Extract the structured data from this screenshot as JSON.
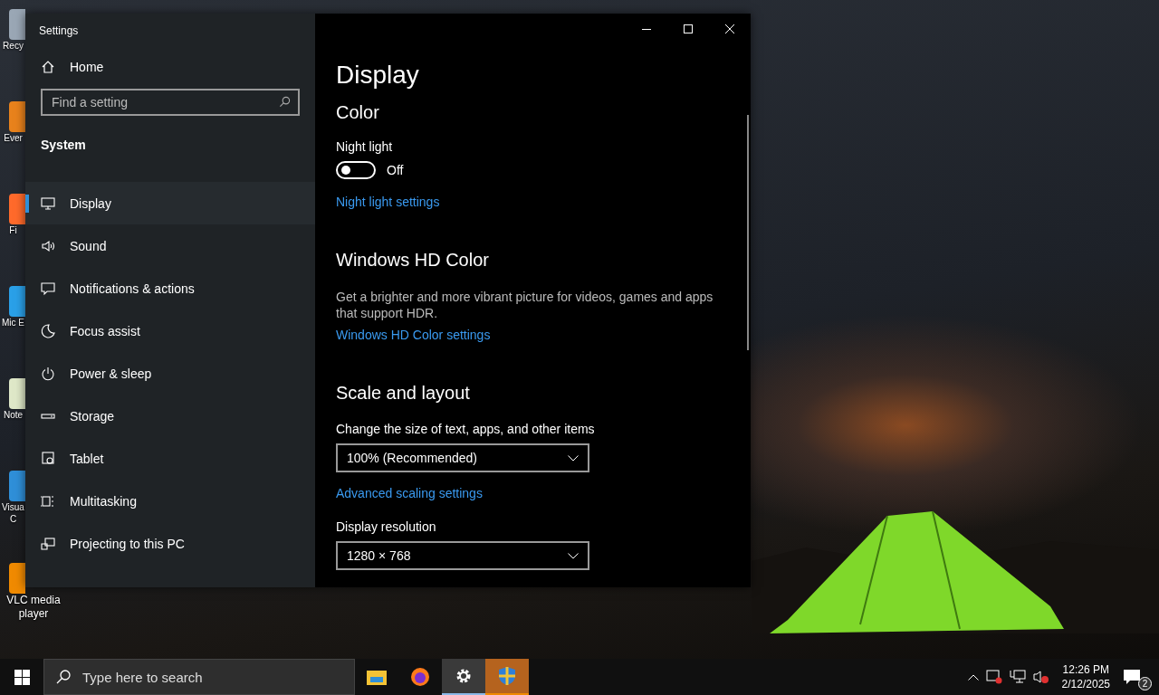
{
  "desktop_icons": [
    {
      "label": "Recy"
    },
    {
      "label": "Ever"
    },
    {
      "label": "Fi"
    },
    {
      "label": "Mic E"
    },
    {
      "label": "Note"
    },
    {
      "label": "Visua C"
    },
    {
      "label": "VLC media player"
    }
  ],
  "window": {
    "title": "Settings"
  },
  "sidebar": {
    "home": "Home",
    "search": {
      "placeholder": "Find a setting"
    },
    "section": "System",
    "items": [
      {
        "label": "Display",
        "selected": true
      },
      {
        "label": "Sound",
        "selected": false
      },
      {
        "label": "Notifications & actions",
        "selected": false
      },
      {
        "label": "Focus assist",
        "selected": false
      },
      {
        "label": "Power & sleep",
        "selected": false
      },
      {
        "label": "Storage",
        "selected": false
      },
      {
        "label": "Tablet",
        "selected": false
      },
      {
        "label": "Multitasking",
        "selected": false
      },
      {
        "label": "Projecting to this PC",
        "selected": false
      }
    ]
  },
  "content": {
    "title": "Display",
    "color": {
      "heading": "Color",
      "night_light_label": "Night light",
      "night_light": {
        "on": false,
        "state_text": "Off"
      },
      "link": "Night light settings"
    },
    "hd_color": {
      "heading": "Windows HD Color",
      "description": "Get a brighter and more vibrant picture for videos, games and apps that support HDR.",
      "link": "Windows HD Color settings"
    },
    "scale": {
      "heading": "Scale and layout",
      "size_label": "Change the size of text, apps, and other items",
      "size_value": "100% (Recommended)",
      "link": "Advanced scaling settings",
      "resolution_label": "Display resolution",
      "resolution_value": "1280 × 768"
    }
  },
  "taskbar": {
    "search": {
      "placeholder": "Type here to search"
    },
    "apps": [
      {
        "selected": false,
        "flashing": false
      },
      {
        "selected": false,
        "flashing": false
      },
      {
        "selected": true,
        "flashing": false
      },
      {
        "selected": false,
        "flashing": true
      }
    ],
    "time": "12:26 PM",
    "date": "2/12/2025",
    "notification_count": "2"
  }
}
